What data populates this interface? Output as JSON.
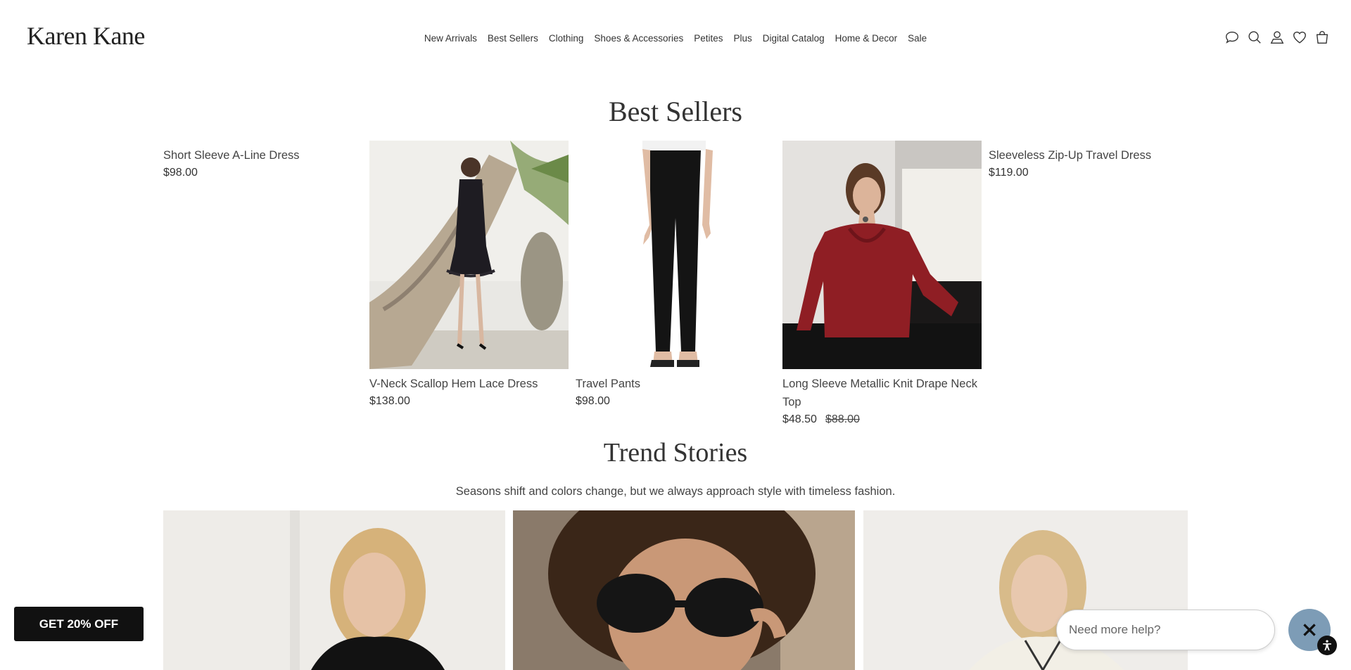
{
  "brand": {
    "logo_text": "Karen Kane"
  },
  "nav": {
    "items": [
      "New Arrivals",
      "Best Sellers",
      "Clothing",
      "Shoes & Accessories",
      "Petites",
      "Plus",
      "Digital Catalog",
      "Home & Decor",
      "Sale"
    ]
  },
  "header_icons": [
    "chat-icon",
    "search-icon",
    "account-icon",
    "wishlist-heart-icon",
    "shopping-bag-icon"
  ],
  "best_sellers": {
    "title": "Best Sellers",
    "products": [
      {
        "name": "Short Sleeve A-Line Dress",
        "price": "$98.00"
      },
      {
        "name": "V-Neck Scallop Hem Lace Dress",
        "price": "$138.00"
      },
      {
        "name": "Travel Pants",
        "price": "$98.00"
      },
      {
        "name": "Long Sleeve Metallic Knit Drape Neck Top",
        "price": "$48.50",
        "original_price": "$88.00"
      },
      {
        "name": "Sleeveless Zip-Up Travel Dress",
        "price": "$119.00"
      }
    ]
  },
  "trend_stories": {
    "title": "Trend Stories",
    "subtitle": "Seasons shift and colors change, but we always approach style with timeless fashion."
  },
  "promo": {
    "label": "GET 20% OFF"
  },
  "help": {
    "placeholder": "Need more help?"
  },
  "colors": {
    "promo_bg": "#111111",
    "close_button_bg": "#7d9cb6",
    "text": "#333333"
  }
}
